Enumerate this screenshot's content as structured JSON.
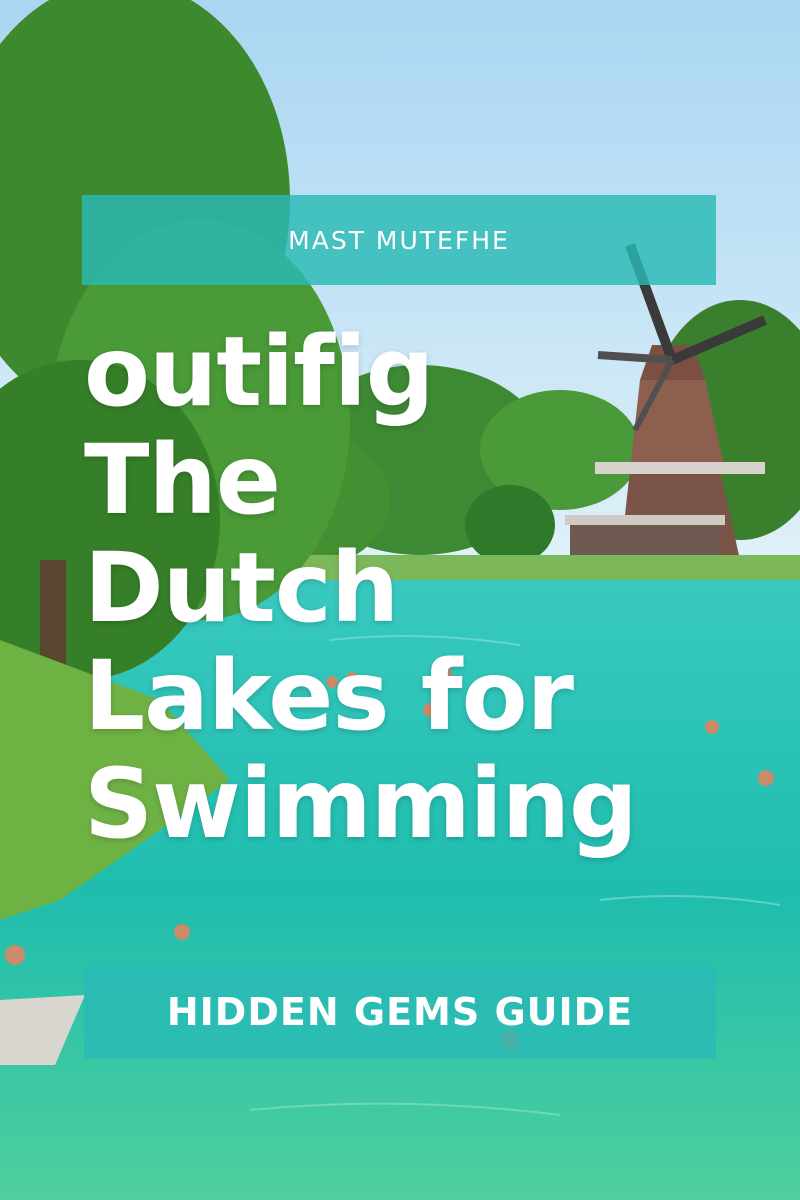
{
  "top_banner": {
    "text": "MAST MUTEFHE"
  },
  "headline": {
    "lines": [
      "outifig",
      "The",
      "Dutch",
      "Lakes for",
      "Swimming"
    ]
  },
  "bottom_banner": {
    "text": "HIDDEN GEMS GUIDE"
  },
  "colors": {
    "sky": "#cfe8f6",
    "water": "#1fc2b6",
    "banner": "#2ababa",
    "foliage": "#3f8f2c",
    "windmill": "#8a5a4a"
  }
}
